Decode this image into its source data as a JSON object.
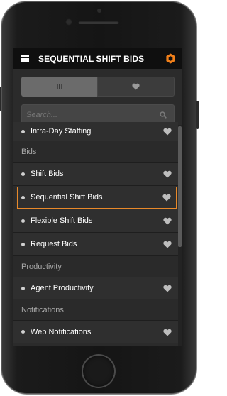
{
  "header": {
    "title": "SEQUENTIAL SHIFT BIDS"
  },
  "tabs": [
    {
      "icon": "bars-view-icon",
      "active": true
    },
    {
      "icon": "heart-icon",
      "active": false
    }
  ],
  "search": {
    "placeholder": "Search...",
    "value": ""
  },
  "list": {
    "items": [
      {
        "type": "item",
        "label": "Intra-Day Staffing"
      },
      {
        "type": "section",
        "label": "Bids"
      },
      {
        "type": "item",
        "label": "Shift Bids"
      },
      {
        "type": "item",
        "label": "Sequential Shift Bids",
        "selected": true
      },
      {
        "type": "item",
        "label": "Flexible Shift Bids"
      },
      {
        "type": "item",
        "label": "Request Bids"
      },
      {
        "type": "section",
        "label": "Productivity"
      },
      {
        "type": "item",
        "label": "Agent Productivity"
      },
      {
        "type": "section",
        "label": "Notifications"
      },
      {
        "type": "item",
        "label": "Web Notifications"
      }
    ]
  },
  "colors": {
    "accent": "#e8892a",
    "logo": "#f07f1a",
    "background": "#2b2b2b",
    "topbar": "#0f0f0f"
  }
}
